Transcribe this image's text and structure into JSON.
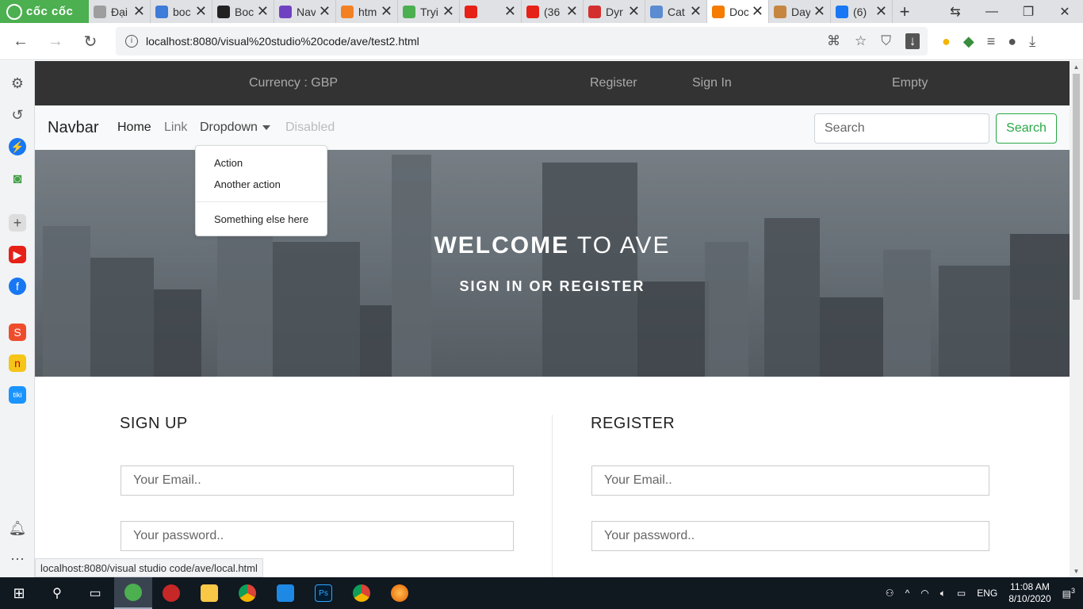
{
  "browser": {
    "logo_text": "cốc cốc",
    "tabs": [
      {
        "title": "Đại",
        "color": "#9e9e9e"
      },
      {
        "title": "boc",
        "color": "#3f7bd8"
      },
      {
        "title": "Boc",
        "color": "#222222"
      },
      {
        "title": "Nav",
        "color": "#6f42c1"
      },
      {
        "title": "htm",
        "color": "#f48024"
      },
      {
        "title": "Tryi",
        "color": "#4caf50"
      },
      {
        "title": "",
        "color": "#e62117"
      },
      {
        "title": "(36",
        "color": "#e62117"
      },
      {
        "title": "Dyr",
        "color": "#d32f2f"
      },
      {
        "title": "Cat",
        "color": "#5b8bd0"
      },
      {
        "title": "Doc",
        "color": "#f57c00",
        "active": true
      },
      {
        "title": "Day",
        "color": "#c68642"
      },
      {
        "title": "(6)",
        "color": "#1877f2"
      }
    ],
    "url": "localhost:8080/visual%20studio%20code/ave/test2.html",
    "status_url": "localhost:8080/visual studio code/ave/local.html"
  },
  "topbar": {
    "currency": "Currency : GBP",
    "register": "Register",
    "sign_in": "Sign In",
    "empty": "Empty"
  },
  "navbar": {
    "brand": "Navbar",
    "home": "Home",
    "link": "Link",
    "dropdown": "Dropdown",
    "disabled": "Disabled",
    "search_placeholder": "Search",
    "search_button": "Search"
  },
  "dropdown_menu": {
    "items": [
      "Action",
      "Another action",
      "Something else here"
    ]
  },
  "hero": {
    "title_bold": "WELCOME",
    "title_rest": " TO AVE",
    "subtitle": "SIGN IN OR REGISTER"
  },
  "signup": {
    "title": "SIGN UP",
    "email_placeholder": "Your Email..",
    "password_placeholder": "Your password.."
  },
  "register": {
    "title": "REGISTER",
    "email_placeholder": "Your Email..",
    "password_placeholder": "Your password.."
  },
  "taskbar": {
    "language": "ENG",
    "time": "11:08 AM",
    "date": "8/10/2020",
    "notifications": "3"
  }
}
